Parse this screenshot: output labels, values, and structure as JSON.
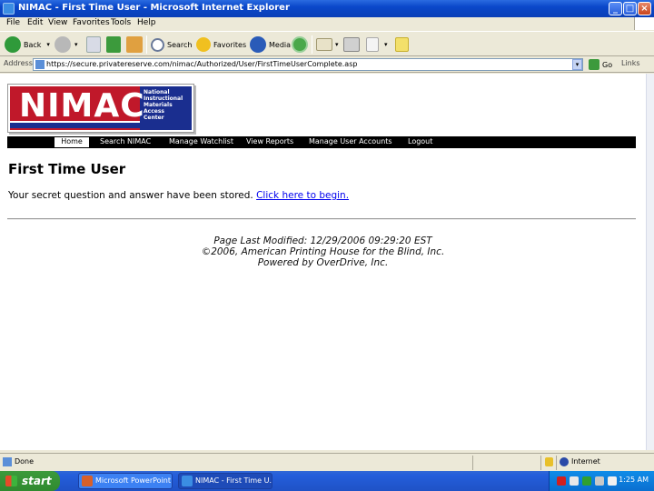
{
  "window": {
    "title": "NIMAC - First Time User - Microsoft Internet Explorer",
    "controls": {
      "minimize": "_",
      "maximize": "□",
      "close": "×"
    }
  },
  "menu": [
    "File",
    "Edit",
    "View",
    "Favorites",
    "Tools",
    "Help"
  ],
  "toolbar": {
    "back_label": "Back",
    "search_label": "Search",
    "favorites_label": "Favorites",
    "media_label": "Media"
  },
  "addressbar": {
    "label": "Address",
    "url": "https://secure.privatereserve.com/nimac/Authorized/User/FirstTimeUserComplete.asp",
    "go_label": "Go",
    "links_label": "Links"
  },
  "page": {
    "logo": {
      "word": "NIMAC",
      "tagline": [
        "National",
        "Instructional",
        "Materials",
        "Access",
        "Center"
      ],
      "colors": {
        "red": "#c0182a",
        "blue": "#1a2e8f"
      }
    },
    "nav": [
      "Home",
      "Search NIMAC",
      "Manage Watchlist",
      "View Reports",
      "Manage User Accounts",
      "Logout"
    ],
    "title": "First Time User",
    "message": "Your secret question and answer have been stored.",
    "message_link": "Click here to begin.",
    "footer": [
      "Page Last Modified: 12/29/2006 09:29:20 EST",
      "©2006, American Printing House for the Blind, Inc.",
      "Powered by OverDrive, Inc."
    ]
  },
  "statusbar": {
    "status": "Done",
    "zone": "Internet"
  },
  "taskbar": {
    "start_label": "start",
    "tasks": [
      {
        "label": "Microsoft PowerPoint ..."
      },
      {
        "label": "NIMAC - First Time U..."
      }
    ],
    "clock": "1:25 AM"
  }
}
